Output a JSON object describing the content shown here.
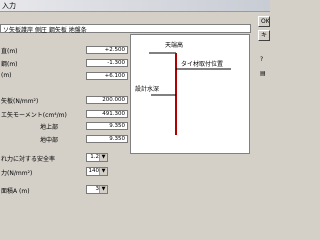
{
  "window": {
    "title": "入力"
  },
  "description": "ソ矢板護岸 側圧 鋼矢板 地盤条",
  "rows": [
    {
      "label": "直(m)",
      "value": "+2.500"
    },
    {
      "label": "鋼(m)",
      "value": "-1.300"
    },
    {
      "label": "(m)",
      "value": "+6.100"
    },
    {
      "label": "矢板(N/mm²)",
      "value": "200.000"
    },
    {
      "label": "エ矢モーメント(cm⁴/m)",
      "value": "491.300"
    },
    {
      "label": "地上部",
      "value": "9.350"
    },
    {
      "label": "地中部",
      "value": "9.350"
    },
    {
      "label": "れ力に対する安全率",
      "value": "1.2"
    },
    {
      "label": "力(N/mm²)",
      "value": "140"
    },
    {
      "label": "面積A (m)",
      "value": "3"
    }
  ],
  "diagram": {
    "top_label": "天端高",
    "tie_label": "タイ材取付位置",
    "depth_label": "設計水深"
  },
  "buttons": [
    "OK",
    "キャンセル"
  ],
  "icons": {
    "help": "help-icon",
    "sheet": "sheet-icon"
  }
}
